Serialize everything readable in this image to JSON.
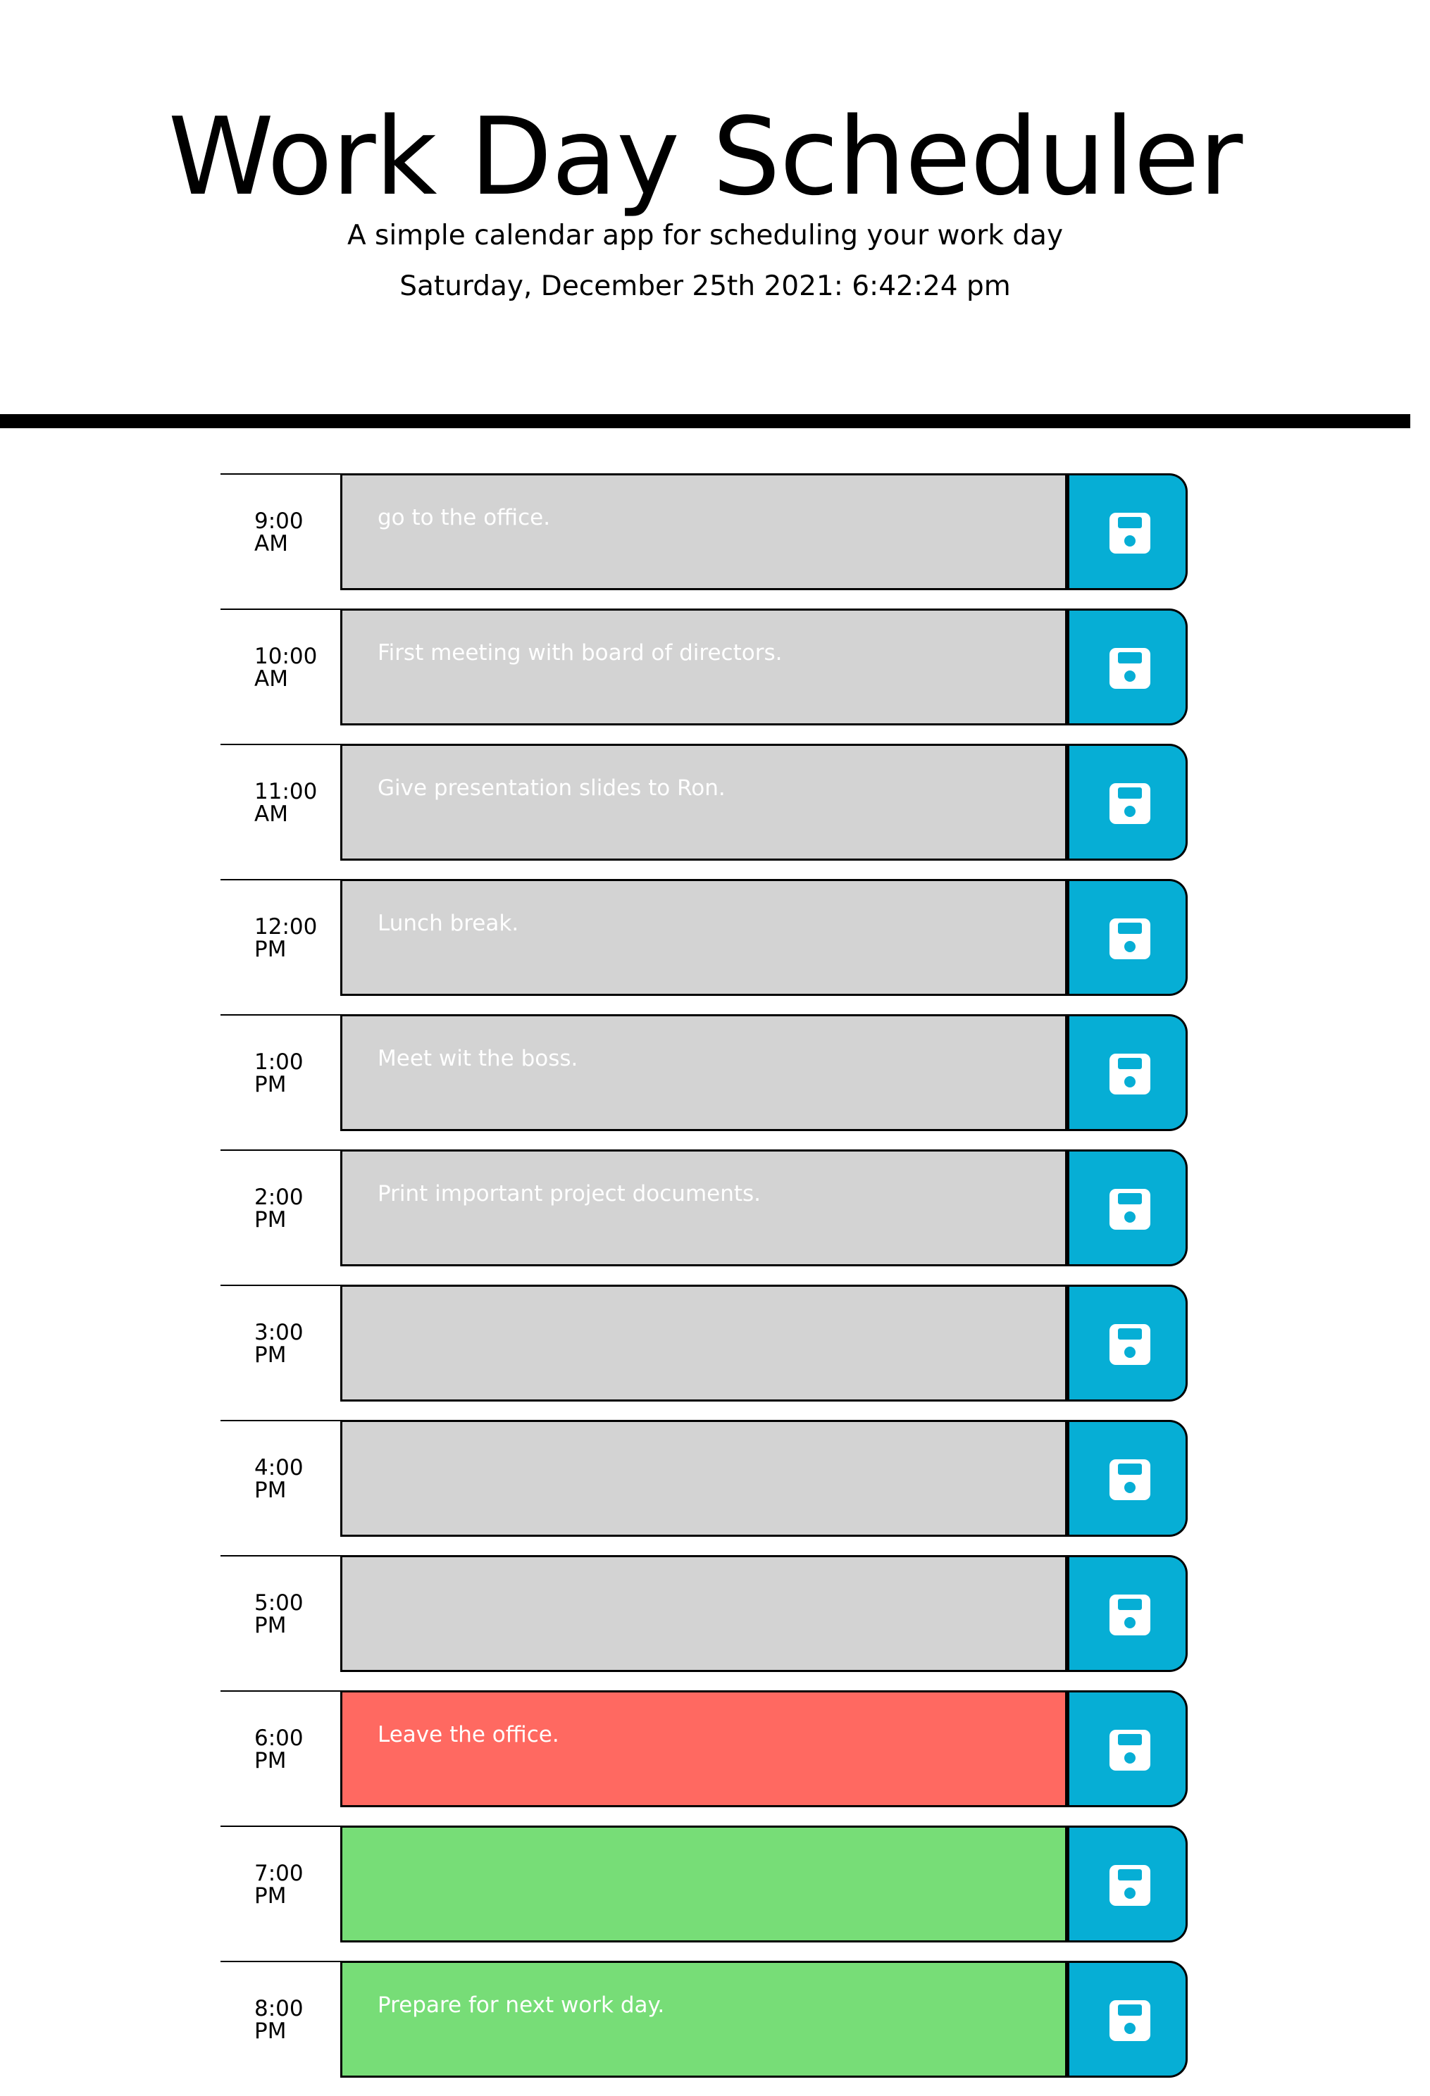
{
  "header": {
    "title": "Work Day Scheduler",
    "tagline": "A simple calendar app for scheduling your work day",
    "current_day": "Saturday, December 25th 2021: 6:42:24 pm"
  },
  "colors": {
    "past": "#d3d3d3",
    "present": "#ff6961",
    "future": "#77dd77",
    "save_button": "#06aed5"
  },
  "time_blocks": [
    {
      "hour": "9:00\nAM",
      "text": "go to the office.",
      "status": "past"
    },
    {
      "hour": "10:00\nAM",
      "text": "First meeting with board of directors.",
      "status": "past"
    },
    {
      "hour": "11:00\nAM",
      "text": "Give presentation slides to Ron.",
      "status": "past"
    },
    {
      "hour": "12:00\nPM",
      "text": "Lunch break.",
      "status": "past"
    },
    {
      "hour": "1:00\nPM",
      "text": "Meet wit the boss.",
      "status": "past"
    },
    {
      "hour": "2:00\nPM",
      "text": "Print important project documents.",
      "status": "past"
    },
    {
      "hour": "3:00\nPM",
      "text": "",
      "status": "past"
    },
    {
      "hour": "4:00\nPM",
      "text": "",
      "status": "past"
    },
    {
      "hour": "5:00\nPM",
      "text": "",
      "status": "past"
    },
    {
      "hour": "6:00\nPM",
      "text": "Leave the office.",
      "status": "present"
    },
    {
      "hour": "7:00\nPM",
      "text": "",
      "status": "future"
    },
    {
      "hour": "8:00\nPM",
      "text": "Prepare for next work day.",
      "status": "future"
    }
  ],
  "save_icon": "floppy-disk-icon"
}
